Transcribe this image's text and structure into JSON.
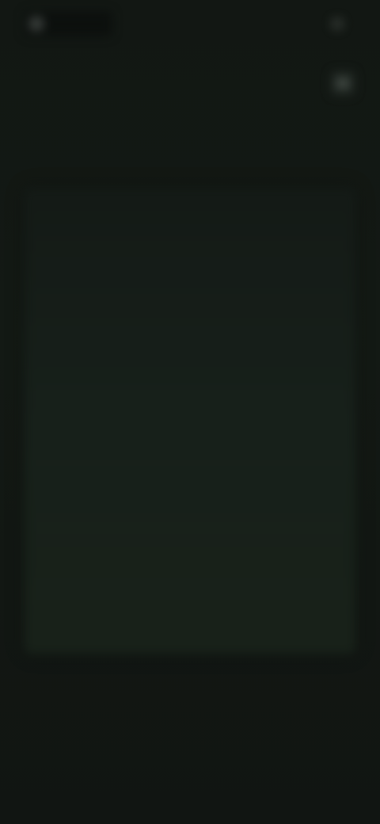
{
  "header": {
    "brand_name": "",
    "action_label": ""
  },
  "nav": {
    "back_label": "",
    "menu_icon": "menu-icon"
  },
  "page": {
    "title": ""
  },
  "list": {
    "items": [
      {
        "label": ""
      },
      {
        "label": ""
      },
      {
        "label": ""
      },
      {
        "label": ""
      },
      {
        "label": ""
      },
      {
        "label": ""
      },
      {
        "label": ""
      }
    ]
  },
  "colors": {
    "background": "#121713",
    "accent": "#2d7a4e",
    "panel": "#17201a",
    "text": "#dfe4df"
  }
}
